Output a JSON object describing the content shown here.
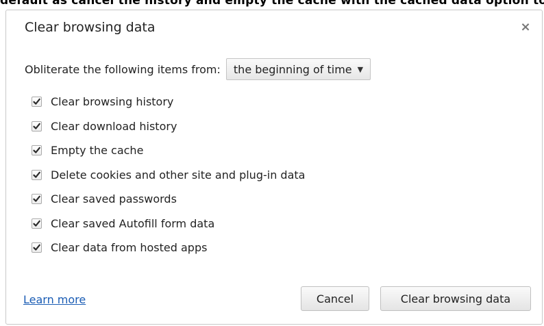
{
  "top_strip_text": "default as cancel the history and empty the cache with the cached data option to clear",
  "dialog": {
    "title": "Clear browsing data",
    "close_symbol": "×"
  },
  "time_range": {
    "label": "Obliterate the following items from:",
    "selected": "the beginning of time",
    "caret": "▼"
  },
  "options": [
    {
      "label": "Clear browsing history",
      "checked": true
    },
    {
      "label": "Clear download history",
      "checked": true
    },
    {
      "label": "Empty the cache",
      "checked": true
    },
    {
      "label": "Delete cookies and other site and plug-in data",
      "checked": true
    },
    {
      "label": "Clear saved passwords",
      "checked": true
    },
    {
      "label": "Clear saved Autofill form data",
      "checked": true
    },
    {
      "label": "Clear data from hosted apps",
      "checked": true
    }
  ],
  "footer": {
    "learn_more": "Learn more",
    "cancel": "Cancel",
    "confirm": "Clear browsing data"
  },
  "icons": {
    "close": "close-icon",
    "caret": "chevron-down-icon",
    "check": "checkmark-icon"
  },
  "colors": {
    "link": "#1a5cb4",
    "text": "#222222",
    "border": "#c8c8c8"
  }
}
